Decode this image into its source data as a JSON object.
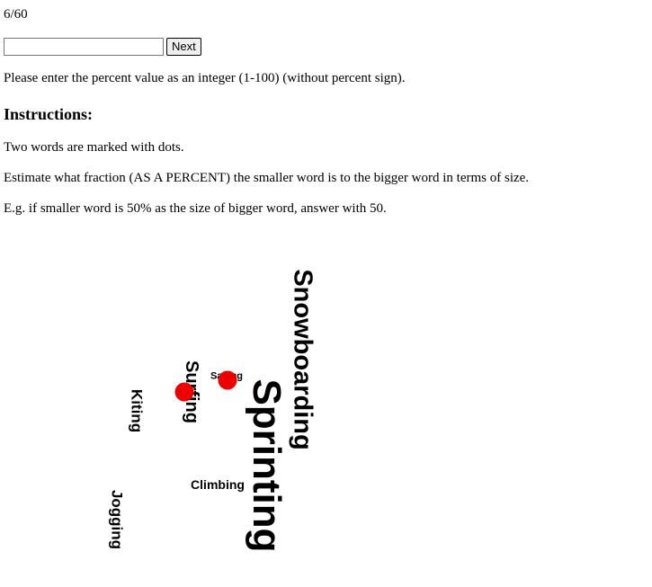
{
  "progress": "6/60",
  "answer": {
    "value": "",
    "placeholder": ""
  },
  "next_label": "Next",
  "hint": "Please enter the percent value as an integer (1-100) (without percent sign).",
  "instructions": {
    "heading": "Instructions:",
    "line1": "Two words are marked with dots.",
    "line2": "Estimate what fraction (AS A PERCENT) the smaller word is to the bigger word in terms of size.",
    "line3": "E.g. if smaller word is 50% as the size of bigger word, answer with 50."
  },
  "word_cloud": {
    "words": {
      "snowboarding": "Snowboarding",
      "sprinting": "Sprinting",
      "surfing": "Surfing",
      "sailing": "Sailing",
      "kiting": "Kiting",
      "climbing": "Climbing",
      "jogging": "Jogging"
    },
    "marked_words": [
      "Surfing",
      "Sailing"
    ],
    "dot_color": "#ee0000"
  }
}
